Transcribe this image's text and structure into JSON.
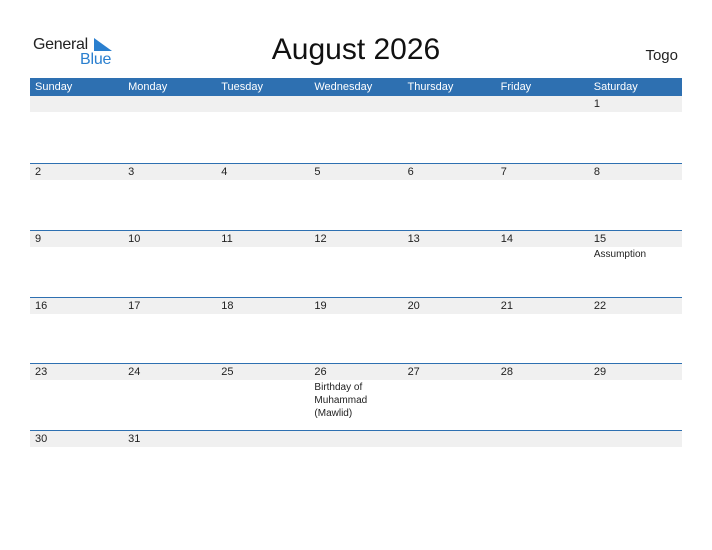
{
  "logo": {
    "general": "General",
    "blue": "Blue",
    "accent": "#2a7fcf"
  },
  "title": "August 2026",
  "country": "Togo",
  "colors": {
    "header_bg": "#2e70b1",
    "strip_bg": "#f0f0f0"
  },
  "weekdays": [
    "Sunday",
    "Monday",
    "Tuesday",
    "Wednesday",
    "Thursday",
    "Friday",
    "Saturday"
  ],
  "weeks": [
    {
      "days": [
        {
          "num": "",
          "holiday": ""
        },
        {
          "num": "",
          "holiday": ""
        },
        {
          "num": "",
          "holiday": ""
        },
        {
          "num": "",
          "holiday": ""
        },
        {
          "num": "",
          "holiday": ""
        },
        {
          "num": "",
          "holiday": ""
        },
        {
          "num": "1",
          "holiday": ""
        }
      ]
    },
    {
      "days": [
        {
          "num": "2",
          "holiday": ""
        },
        {
          "num": "3",
          "holiday": ""
        },
        {
          "num": "4",
          "holiday": ""
        },
        {
          "num": "5",
          "holiday": ""
        },
        {
          "num": "6",
          "holiday": ""
        },
        {
          "num": "7",
          "holiday": ""
        },
        {
          "num": "8",
          "holiday": ""
        }
      ]
    },
    {
      "days": [
        {
          "num": "9",
          "holiday": ""
        },
        {
          "num": "10",
          "holiday": ""
        },
        {
          "num": "11",
          "holiday": ""
        },
        {
          "num": "12",
          "holiday": ""
        },
        {
          "num": "13",
          "holiday": ""
        },
        {
          "num": "14",
          "holiday": ""
        },
        {
          "num": "15",
          "holiday": "Assumption"
        }
      ]
    },
    {
      "days": [
        {
          "num": "16",
          "holiday": ""
        },
        {
          "num": "17",
          "holiday": ""
        },
        {
          "num": "18",
          "holiday": ""
        },
        {
          "num": "19",
          "holiday": ""
        },
        {
          "num": "20",
          "holiday": ""
        },
        {
          "num": "21",
          "holiday": ""
        },
        {
          "num": "22",
          "holiday": ""
        }
      ]
    },
    {
      "days": [
        {
          "num": "23",
          "holiday": ""
        },
        {
          "num": "24",
          "holiday": ""
        },
        {
          "num": "25",
          "holiday": ""
        },
        {
          "num": "26",
          "holiday": "Birthday of Muhammad (Mawlid)"
        },
        {
          "num": "27",
          "holiday": ""
        },
        {
          "num": "28",
          "holiday": ""
        },
        {
          "num": "29",
          "holiday": ""
        }
      ]
    },
    {
      "days": [
        {
          "num": "30",
          "holiday": ""
        },
        {
          "num": "31",
          "holiday": ""
        },
        {
          "num": "",
          "holiday": ""
        },
        {
          "num": "",
          "holiday": ""
        },
        {
          "num": "",
          "holiday": ""
        },
        {
          "num": "",
          "holiday": ""
        },
        {
          "num": "",
          "holiday": ""
        }
      ]
    }
  ]
}
